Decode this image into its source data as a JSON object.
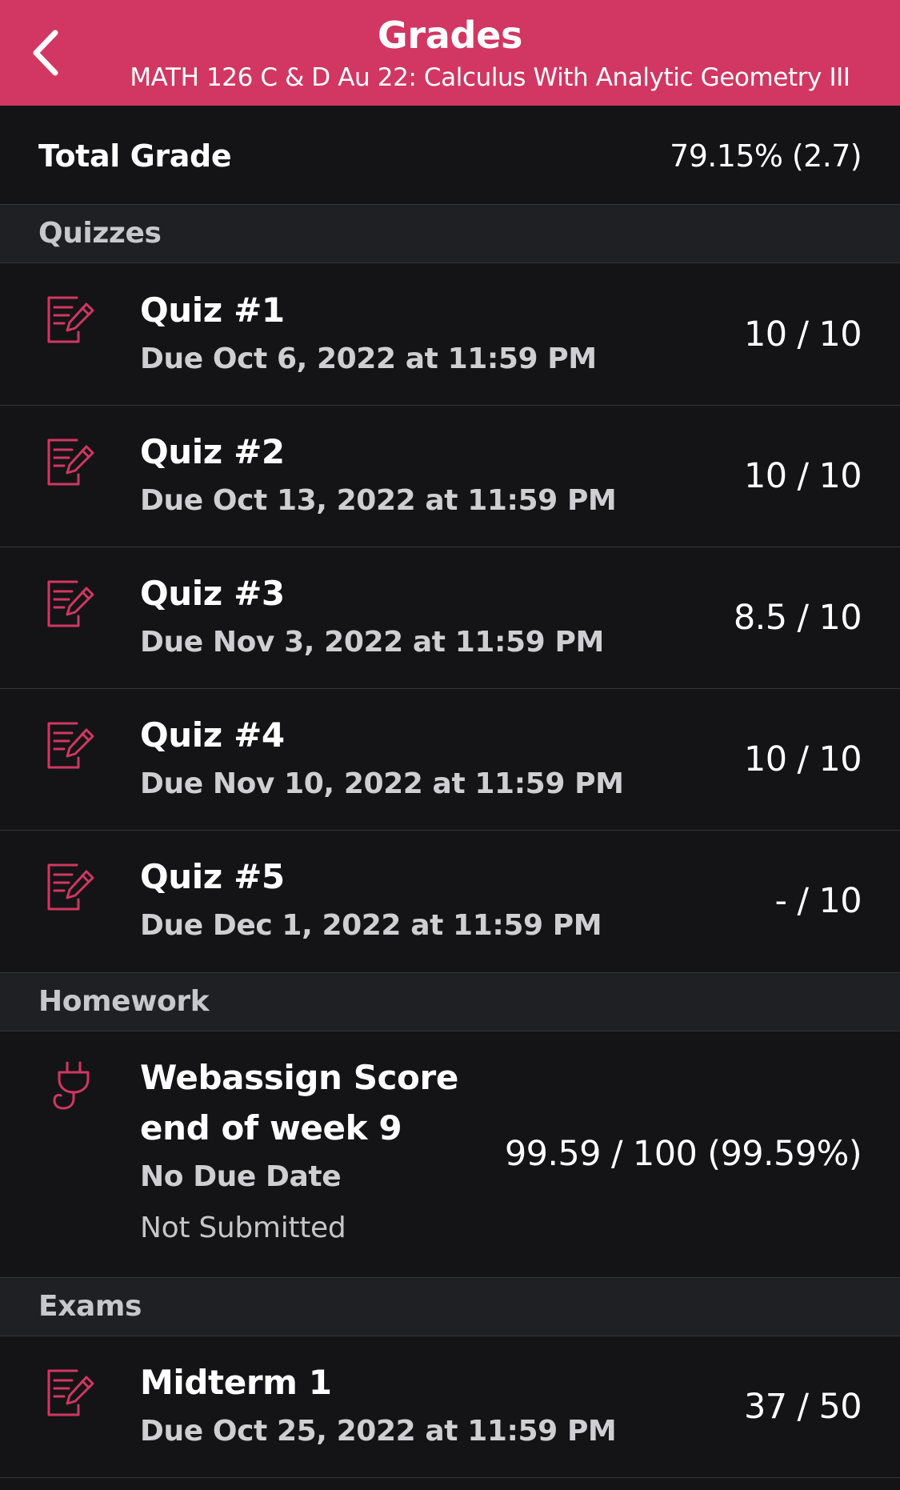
{
  "header": {
    "title": "Grades",
    "subtitle": "MATH 126 C & D  Au 22: Calculus With Analytic Geometry III",
    "back_icon": "chevron-left-icon",
    "background_color": "#d13762"
  },
  "total": {
    "label": "Total Grade",
    "value": "79.15% (2.7)"
  },
  "sections": {
    "quizzes": {
      "label": "Quizzes",
      "items": [
        {
          "title": "Quiz #1",
          "due": "Due Oct 6, 2022 at 11:59 PM",
          "score": "10 / 10",
          "icon": "assignment-edit-icon"
        },
        {
          "title": "Quiz #2",
          "due": "Due Oct 13, 2022 at 11:59 PM",
          "score": "10 / 10",
          "icon": "assignment-edit-icon"
        },
        {
          "title": "Quiz #3",
          "due": "Due Nov 3, 2022 at 11:59 PM",
          "score": "8.5 / 10",
          "icon": "assignment-edit-icon"
        },
        {
          "title": "Quiz #4",
          "due": "Due Nov 10, 2022 at 11:59 PM",
          "score": "10 / 10",
          "icon": "assignment-edit-icon"
        },
        {
          "title": "Quiz #5",
          "due": "Due Dec 1, 2022 at 11:59 PM",
          "score": "- / 10",
          "icon": "assignment-edit-icon"
        }
      ]
    },
    "homework": {
      "label": "Homework",
      "items": [
        {
          "title_line1": "Webassign Score",
          "title_line2": "end of week 9",
          "due": "No Due Date",
          "status": "Not Submitted",
          "score": "99.59 / 100 (99.59%)",
          "icon": "plug-icon"
        }
      ]
    },
    "exams": {
      "label": "Exams",
      "items": [
        {
          "title": "Midterm 1",
          "due": "Due Oct 25, 2022 at 11:59 PM",
          "score": "37 / 50",
          "icon": "assignment-edit-icon"
        }
      ]
    }
  },
  "colors": {
    "accent": "#d13762",
    "background": "#141416",
    "section_background": "#1e2024",
    "divider": "#34363b"
  }
}
